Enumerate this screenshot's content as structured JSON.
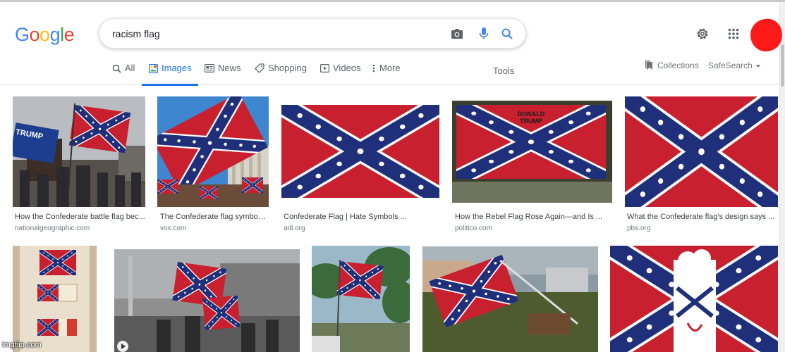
{
  "logo": {
    "letters": [
      "G",
      "o",
      "o",
      "g",
      "l",
      "e"
    ],
    "colors": [
      "#4285f4",
      "#ea4335",
      "#fbbc05",
      "#4285f4",
      "#34a853",
      "#ea4335"
    ]
  },
  "search": {
    "query": "racism flag",
    "camera_icon": "camera-icon",
    "mic_icon": "mic-icon",
    "search_icon": "search-icon"
  },
  "header_icons": {
    "settings": "gear-icon",
    "apps": "apps-grid-icon"
  },
  "tabs": [
    {
      "label": "All",
      "icon": "search-icon"
    },
    {
      "label": "Images",
      "icon": "image-icon",
      "active": true
    },
    {
      "label": "News",
      "icon": "news-icon"
    },
    {
      "label": "Shopping",
      "icon": "tag-icon"
    },
    {
      "label": "Videos",
      "icon": "video-icon"
    },
    {
      "label": "More",
      "icon": "kebab-icon"
    }
  ],
  "tools_label": "Tools",
  "collections_label": "Collections",
  "safesearch_label": "SafeSearch",
  "results_row1": [
    {
      "caption": "How the Confederate battle flag bec...",
      "source": "nationalgeographic.com"
    },
    {
      "caption": "The Confederate flag symboli...",
      "source": "vox.com"
    },
    {
      "caption": "Confederate Flag | Hate Symbols ...",
      "source": "adl.org"
    },
    {
      "caption": "How the Rebel Flag Rose Again—and Is ...",
      "source": "politico.com"
    },
    {
      "caption": "What the Confederate flag's design says ...",
      "source": "pbs.org"
    }
  ],
  "image_texts": {
    "trump_sign": "TRUMP",
    "donald_trump": "DONALD\nTRUMP"
  },
  "watermark": "imgflip.com",
  "colors": {
    "accent": "#1a73e8",
    "flag_red": "#c8202f",
    "flag_blue": "#1f2f7a",
    "avatar_red": "#ff1a1a"
  }
}
